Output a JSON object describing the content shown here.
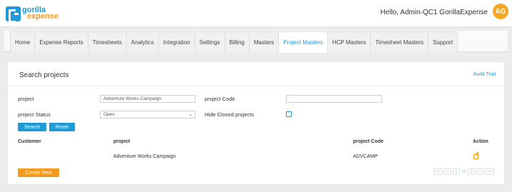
{
  "header": {
    "logo_line1": "gorilla",
    "logo_line2": "expense",
    "greeting": "Hello, Admin-QC1 GorillaExpense",
    "avatar_initials": "AG"
  },
  "nav": {
    "tabs": [
      {
        "label": "Home",
        "active": false
      },
      {
        "label": "Expense Reports",
        "active": false
      },
      {
        "label": "Timesheets",
        "active": false
      },
      {
        "label": "Analytics",
        "active": false
      },
      {
        "label": "Integration",
        "active": false
      },
      {
        "label": "Settings",
        "active": false
      },
      {
        "label": "Billing",
        "active": false
      },
      {
        "label": "Masters",
        "active": false
      },
      {
        "label": "Project Masters",
        "active": true
      },
      {
        "label": "HCP Masters",
        "active": false
      },
      {
        "label": "Timesheet Masters",
        "active": false
      },
      {
        "label": "Support",
        "active": false
      }
    ]
  },
  "panel": {
    "title": "Search projects",
    "audit_trail": "Audit Trail"
  },
  "form": {
    "project_label": "project",
    "project_value": "Adventure Works Campaign",
    "project_code_label": "project Code",
    "project_code_value": "",
    "project_status_label": "project Status",
    "project_status_value": "Open",
    "hide_closed_label": "Hide Closed projects",
    "hide_closed_checked": false,
    "search_button": "Search",
    "reset_button": "Reset"
  },
  "table": {
    "headers": {
      "customer": "Customer",
      "project": "project",
      "project_code": "project Code",
      "action": "Action"
    },
    "rows": [
      {
        "customer": "",
        "project": "Adventure Works Campaign",
        "project_code": "ADVCAMP"
      }
    ]
  },
  "footer": {
    "create_new": "Create New",
    "pager": {
      "first": "<<",
      "prev": "<",
      "current_page": "1",
      "of_label": "of",
      "total_pages": "1",
      "next": ">",
      "last": ">>"
    }
  },
  "colors": {
    "accent_blue": "#1f9ad6",
    "accent_orange": "#f39a1f"
  }
}
